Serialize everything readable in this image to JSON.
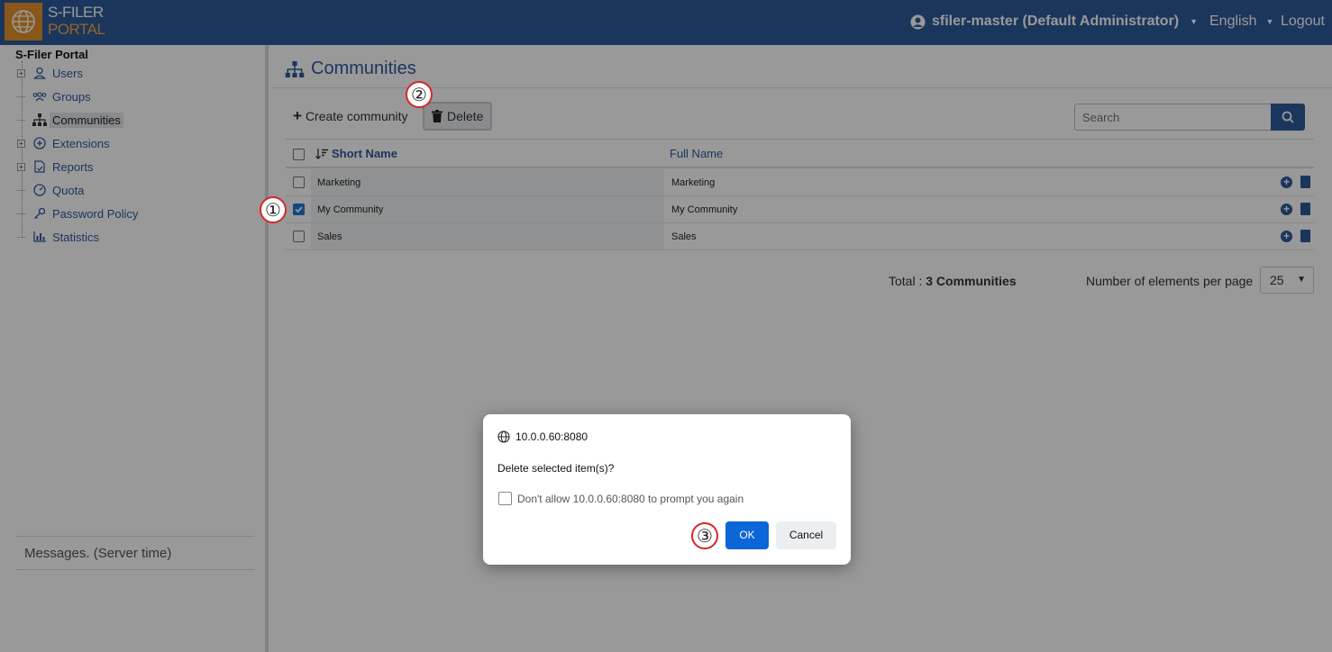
{
  "header": {
    "logo_line1": "S-FILER",
    "logo_line2": "PORTAL",
    "user": "sfiler-master (Default Administrator)",
    "language": "English",
    "logout": "Logout"
  },
  "sidebar": {
    "root": "S-Filer Portal",
    "items": [
      {
        "label": "Users",
        "icon": "user-icon",
        "expandable": true
      },
      {
        "label": "Groups",
        "icon": "groups-icon",
        "expandable": false
      },
      {
        "label": "Communities",
        "icon": "sitemap-icon",
        "expandable": false,
        "active": true
      },
      {
        "label": "Extensions",
        "icon": "plus-circle-icon",
        "expandable": true
      },
      {
        "label": "Reports",
        "icon": "report-icon",
        "expandable": true
      },
      {
        "label": "Quota",
        "icon": "gauge-icon",
        "expandable": false
      },
      {
        "label": "Password Policy",
        "icon": "key-icon",
        "expandable": false
      },
      {
        "label": "Statistics",
        "icon": "bar-chart-icon",
        "expandable": false
      }
    ],
    "messages": "Messages. (Server time)"
  },
  "main": {
    "title": "Communities",
    "create_label": "Create community",
    "delete_label": "Delete",
    "search_placeholder": "Search",
    "columns": {
      "short_name": "Short Name",
      "full_name": "Full Name"
    },
    "rows": [
      {
        "short": "Marketing",
        "full": "Marketing",
        "checked": false
      },
      {
        "short": "My Community",
        "full": "My Community",
        "checked": true
      },
      {
        "short": "Sales",
        "full": "Sales",
        "checked": false
      }
    ],
    "total_label": "Total :",
    "total_value": "3 Communities",
    "per_page_label": "Number of elements per page",
    "per_page_value": "25"
  },
  "dialog": {
    "origin": "10.0.0.60:8080",
    "message": "Delete selected item(s)?",
    "checkbox_label": "Don't allow 10.0.0.60:8080 to prompt you again",
    "ok": "OK",
    "cancel": "Cancel"
  },
  "steps": [
    "①",
    "②",
    "③"
  ],
  "colors": {
    "brand": "#2d5a9c",
    "logo": "#e5912a",
    "ok": "#0b66d8",
    "marker": "#d32828"
  }
}
